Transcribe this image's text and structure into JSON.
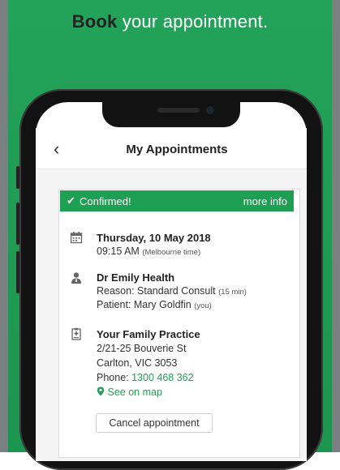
{
  "headline": {
    "bold": "Book",
    "rest": " your appointment."
  },
  "app_bar": {
    "title": "My Appointments",
    "back_glyph": "‹"
  },
  "banner": {
    "status": "Confirmed!",
    "link": "more info",
    "check_glyph": "✔"
  },
  "date_block": {
    "icon": "calendar-icon",
    "date": "Thursday, 10 May 2018",
    "time": "09:15 AM",
    "timezone": "(Melbourne time)"
  },
  "doctor_block": {
    "icon": "doctor-icon",
    "name": "Dr Emily Health",
    "reason_label": "Reason: Standard Consult",
    "duration": "(15 min)",
    "patient_label": "Patient: Mary Goldfin",
    "patient_note": "(you)"
  },
  "practice_block": {
    "icon": "clinic-icon",
    "name": "Your Family Practice",
    "address1": "2/21-25 Bouverie St",
    "address2": "Carlton, VIC 3053",
    "phone_label": "Phone:",
    "phone": "1300 468 362",
    "map_link": "See on map",
    "map_icon": "map-pin-icon"
  },
  "cancel_button": "Cancel appointment",
  "colors": {
    "brand_green": "#1f9f53",
    "background_green": "#23a35a"
  }
}
